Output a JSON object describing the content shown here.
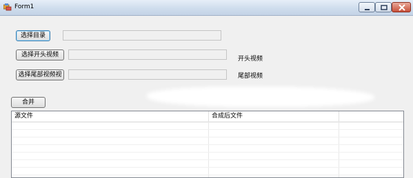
{
  "window": {
    "title": "Form1",
    "icon": "form-app-icon"
  },
  "buttons": {
    "select_dir": "选择目录",
    "select_intro": "选择开头视频",
    "select_outro": "选择尾部视频视",
    "merge": "合并"
  },
  "fields": {
    "dir_path": "",
    "intro_path": "",
    "outro_path": ""
  },
  "labels": {
    "intro": "开头视频",
    "outro": "尾部视频"
  },
  "list": {
    "columns": [
      "源文件",
      "合成后文件",
      ""
    ],
    "rows": []
  }
}
